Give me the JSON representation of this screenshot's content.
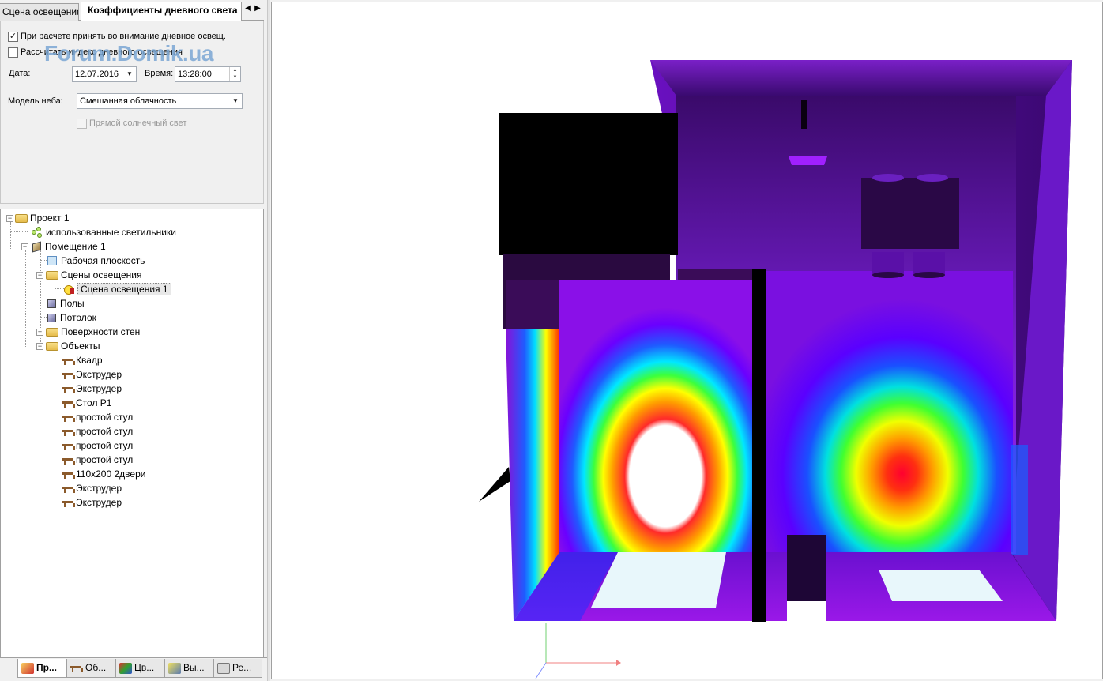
{
  "tabs": [
    {
      "label": "Сцена освещения"
    },
    {
      "label": "Коэффициенты дневного света"
    }
  ],
  "tab_nav": {
    "prev": "◀",
    "next": "▶"
  },
  "props": {
    "consider_daylight": {
      "label": "При расчете принять во внимание дневное освещ.",
      "checked": true
    },
    "calc_daylight_index": {
      "label": "Рассчитать индекс дневного освещения",
      "checked": false
    },
    "date_label": "Дата:",
    "date_value": "12.07.2016",
    "time_label": "Время:",
    "time_value": "13:28:00",
    "sky_model_label": "Модель неба:",
    "sky_model_value": "Смешанная облачность",
    "direct_sun": {
      "label": "Прямой солнечный свет",
      "checked": false,
      "disabled": true
    }
  },
  "watermark": "Forum.Domik.ua",
  "tree": {
    "project": "Проект 1",
    "used_luminaires": "использованные светильники",
    "room": "Помещение 1",
    "work_plane": "Рабочая плоскость",
    "scenes_folder": "Сцены освещения",
    "scene_1": "Сцена освещения 1",
    "floors": "Полы",
    "ceiling": "Потолок",
    "wall_surfaces": "Поверхности стен",
    "objects_folder": "Объекты",
    "objects": [
      "Квадр",
      "Экструдер",
      "Экструдер",
      "Стол Р1",
      "простой стул",
      "простой стул",
      "простой стул",
      "простой стул",
      "110x200 2двери",
      "Экструдер",
      "Экструдер"
    ]
  },
  "bottom_tabs": [
    {
      "label": "Пр...",
      "active": true
    },
    {
      "label": "Об...",
      "active": false
    },
    {
      "label": "Цв...",
      "active": false
    },
    {
      "label": "Вы...",
      "active": false
    },
    {
      "label": "Ре...",
      "active": false
    }
  ]
}
